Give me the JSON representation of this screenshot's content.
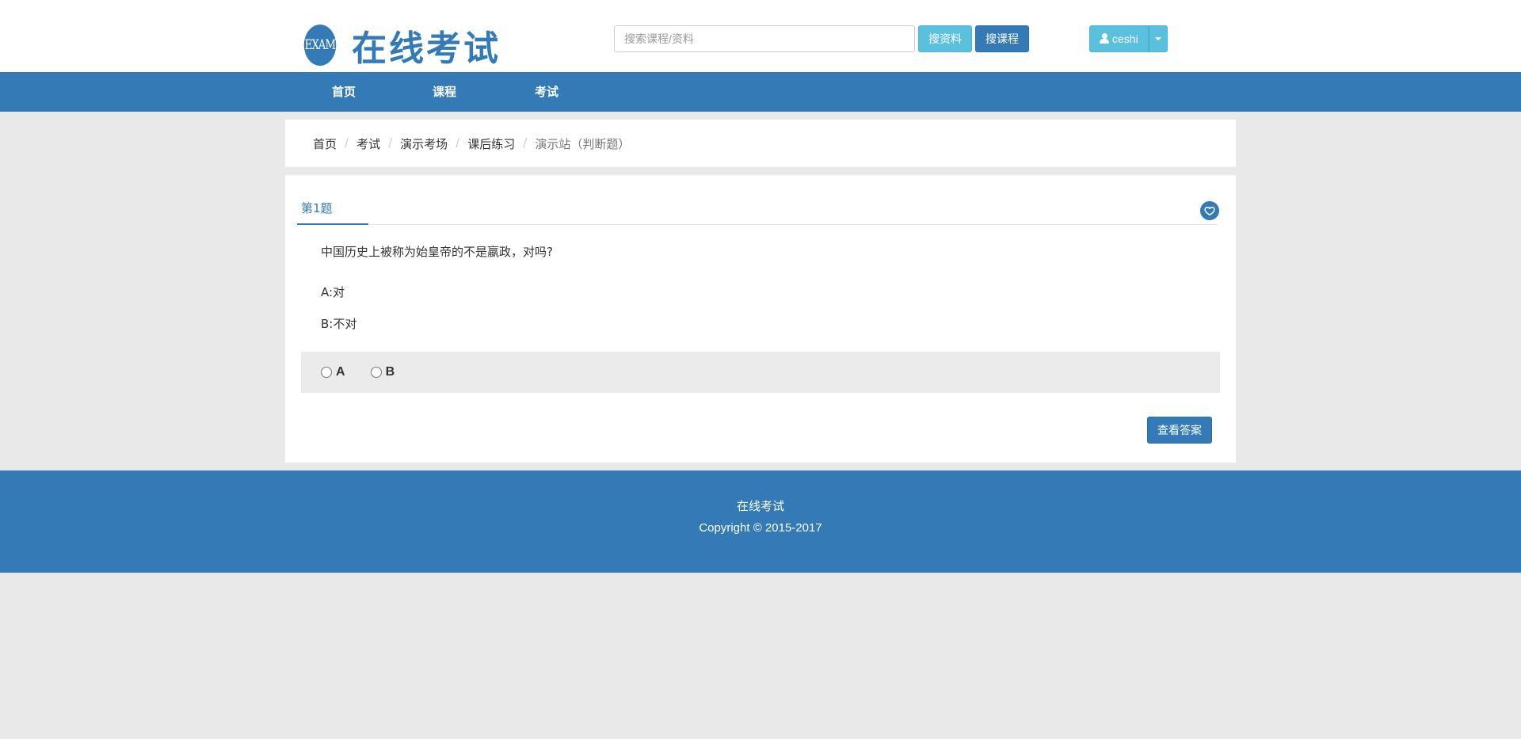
{
  "header": {
    "logo_badge": "EXAM",
    "site_title": "在线考试",
    "search": {
      "placeholder": "搜索课程/资料",
      "value": ""
    },
    "search_material_label": "搜资料",
    "search_course_label": "搜课程",
    "username": "ceshi"
  },
  "nav": {
    "items": [
      {
        "label": "首页"
      },
      {
        "label": "课程"
      },
      {
        "label": "考试"
      }
    ]
  },
  "breadcrumb": {
    "items": [
      "首页",
      "考试",
      "演示考场",
      "课后练习"
    ],
    "current": "演示站（判断题）",
    "separator": "/"
  },
  "question": {
    "number_label": "第1题",
    "text": "中国历史上被称为始皇帝的不是嬴政，对吗?",
    "options": [
      {
        "text": "A:对"
      },
      {
        "text": "B:不对"
      }
    ],
    "answer_choices": [
      "A",
      "B"
    ],
    "view_answer_label": "查看答案"
  },
  "footer": {
    "site_name": "在线考试",
    "copyright": "Copyright © 2015-2017"
  },
  "colors": {
    "primary": "#337ab7",
    "info": "#5bc0de",
    "page_bg": "#e9e9e9"
  }
}
